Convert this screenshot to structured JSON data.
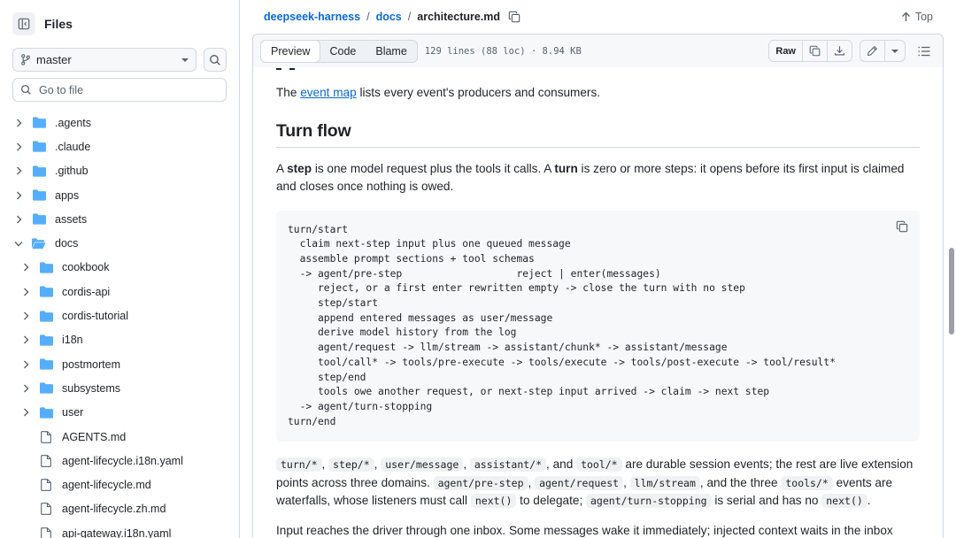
{
  "sidebar": {
    "title": "Files",
    "branch": "master",
    "goto_placeholder": "Go to file",
    "tree": [
      {
        "label": ".agents",
        "kind": "folder"
      },
      {
        "label": ".claude",
        "kind": "folder"
      },
      {
        "label": ".github",
        "kind": "folder"
      },
      {
        "label": "apps",
        "kind": "folder"
      },
      {
        "label": "assets",
        "kind": "folder"
      },
      {
        "label": "docs",
        "kind": "folder-open"
      },
      {
        "label": "cookbook",
        "kind": "folder"
      },
      {
        "label": "cordis-api",
        "kind": "folder"
      },
      {
        "label": "cordis-tutorial",
        "kind": "folder"
      },
      {
        "label": "i18n",
        "kind": "folder"
      },
      {
        "label": "postmortem",
        "kind": "folder"
      },
      {
        "label": "subsystems",
        "kind": "folder"
      },
      {
        "label": "user",
        "kind": "folder"
      },
      {
        "label": "AGENTS.md",
        "kind": "file"
      },
      {
        "label": "agent-lifecycle.i18n.yaml",
        "kind": "file"
      },
      {
        "label": "agent-lifecycle.md",
        "kind": "file"
      },
      {
        "label": "agent-lifecycle.zh.md",
        "kind": "file"
      },
      {
        "label": "api-gateway.i18n.yaml",
        "kind": "file"
      }
    ]
  },
  "breadcrumb": {
    "repo": "deepseek-harness",
    "dir": "docs",
    "file": "architecture.md",
    "sep": "/",
    "top_label": "Top"
  },
  "toolbar": {
    "tabs": [
      "Preview",
      "Code",
      "Blame"
    ],
    "active_tab": "Preview",
    "meta": "129 lines (88 loc) · 8.94 KB",
    "raw_label": "Raw"
  },
  "content": {
    "p_event": {
      "before": "The ",
      "link": "event map",
      "after": " lists every event's producers and consumers."
    },
    "heading": "Turn flow",
    "p_step": {
      "t1": "A ",
      "b1": "step",
      "t2": " is one model request plus the tools it calls. A ",
      "b2": "turn",
      "t3": " is zero or more steps: it opens before its first input is claimed and closes once nothing is owed."
    },
    "code_block": "turn/start\n  claim next-step input plus one queued message\n  assemble prompt sections + tool schemas\n  -> agent/pre-step                   reject | enter(messages)\n     reject, or a first enter rewritten empty -> close the turn with no step\n     step/start\n     append entered messages as user/message\n     derive model history from the log\n     agent/request -> llm/stream -> assistant/chunk* -> assistant/message\n     tool/call* -> tools/pre-execute -> tools/execute -> tools/post-execute -> tool/result*\n     step/end\n     tools owe another request, or next-step input arrived -> claim -> next step\n  -> agent/turn-stopping\nturn/end",
    "p_durable": {
      "c1": "turn/*",
      "s1": ", ",
      "c2": "step/*",
      "s2": ", ",
      "c3": "user/message",
      "s3": ", ",
      "c4": "assistant/*",
      "s4": ", and ",
      "c5": "tool/*",
      "s5": " are durable session events; the rest are live extension points across three domains. ",
      "c6": "agent/pre-step",
      "s6": ", ",
      "c7": "agent/request",
      "s7": ", ",
      "c8": "llm/stream",
      "s8": ", and the three ",
      "c9": "tools/*",
      "s9": " events are waterfalls, whose listeners must call ",
      "c10": "next()",
      "s10": " to delegate; ",
      "c11": "agent/turn-stopping",
      "s11": " is serial and has no ",
      "c12": "next()",
      "s12": "."
    },
    "p_input": "Input reaches the driver through one inbox. Some messages wake it immediately; injected context waits in the inbox"
  },
  "colors": {
    "link": "#0969da",
    "folder": "#54aeff",
    "border": "#d1d9e0"
  }
}
